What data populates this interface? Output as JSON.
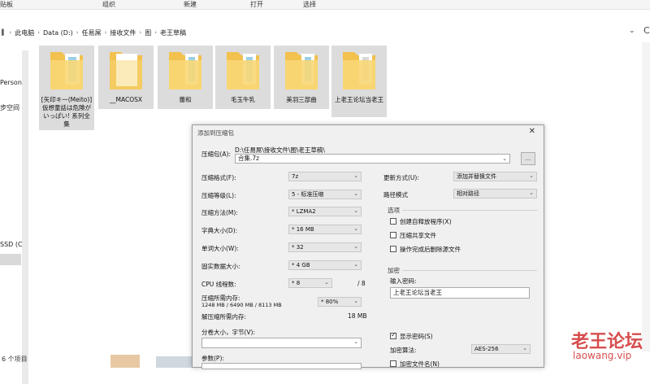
{
  "ribbon": {
    "items": [
      "贴板",
      "组织",
      "新建",
      "打开",
      "选择"
    ]
  },
  "address": {
    "crumbs": [
      "此电脑",
      "Data (D:)",
      "任易屌",
      "接收文件",
      "图",
      "老王草稿"
    ]
  },
  "nav": {
    "items": [
      "Person",
      "步空间",
      "SSD (C"
    ]
  },
  "status": {
    "count": "6 个项目"
  },
  "files": [
    {
      "name": "[矢印キー(Meito)] 仮想童話は危険がいっぱい! 系列全集"
    },
    {
      "name": "__MACOSX"
    },
    {
      "name": "蕾和"
    },
    {
      "name": "毛玉牛乳"
    },
    {
      "name": "美羽三部曲"
    },
    {
      "name": "上老王论坛当老王"
    }
  ],
  "dialog": {
    "title": "添加到压缩包",
    "archive_label": "压缩包(A):",
    "archive_path": "D:\\任易屌\\接收文件\\图\\老王草稿\\",
    "archive_name": "合集.7z",
    "browse_label": "...",
    "fields": [
      {
        "label": "压缩格式(F):",
        "value": "7z"
      },
      {
        "label": "压缩等级(L):",
        "value": "5 - 标准压缩"
      },
      {
        "label": "压缩方法(M):",
        "value": "* LZMA2"
      },
      {
        "label": "字典大小(D):",
        "value": "* 16 MB"
      },
      {
        "label": "单词大小(W):",
        "value": "* 32"
      },
      {
        "label": "固实数据大小:",
        "value": "* 4 GB"
      }
    ],
    "cpu_label": "CPU 线程数:",
    "cpu_value": "* 8",
    "cpu_total": "/ 8",
    "mem_label": "压缩所需内存:",
    "mem_detail": "1248 MB / 6490 MB / 8113 MB",
    "mem_value": "* 80%",
    "decomp_label": "解压缩所需内存:",
    "decomp_value": "18 MB",
    "split_label": "分卷大小，字节(V):",
    "params_label": "参数(P):",
    "update_label": "更新方式(U):",
    "update_value": "添加并替换文件",
    "path_label": "路径模式",
    "path_value": "相对路径",
    "options_title": "选项",
    "options": [
      "创建自释放程序(X)",
      "压缩共享文件",
      "操作完成后删除源文件"
    ],
    "encrypt_title": "加密",
    "password_label": "输入密码:",
    "password_value": "上老王论坛当老王",
    "show_password": "显示密码(S)",
    "algo_label": "加密算法:",
    "algo_value": "AES-256",
    "encrypt_names": "加密文件名(N)"
  },
  "watermark": {
    "title": "老王论坛",
    "url": "laowang.vip"
  }
}
